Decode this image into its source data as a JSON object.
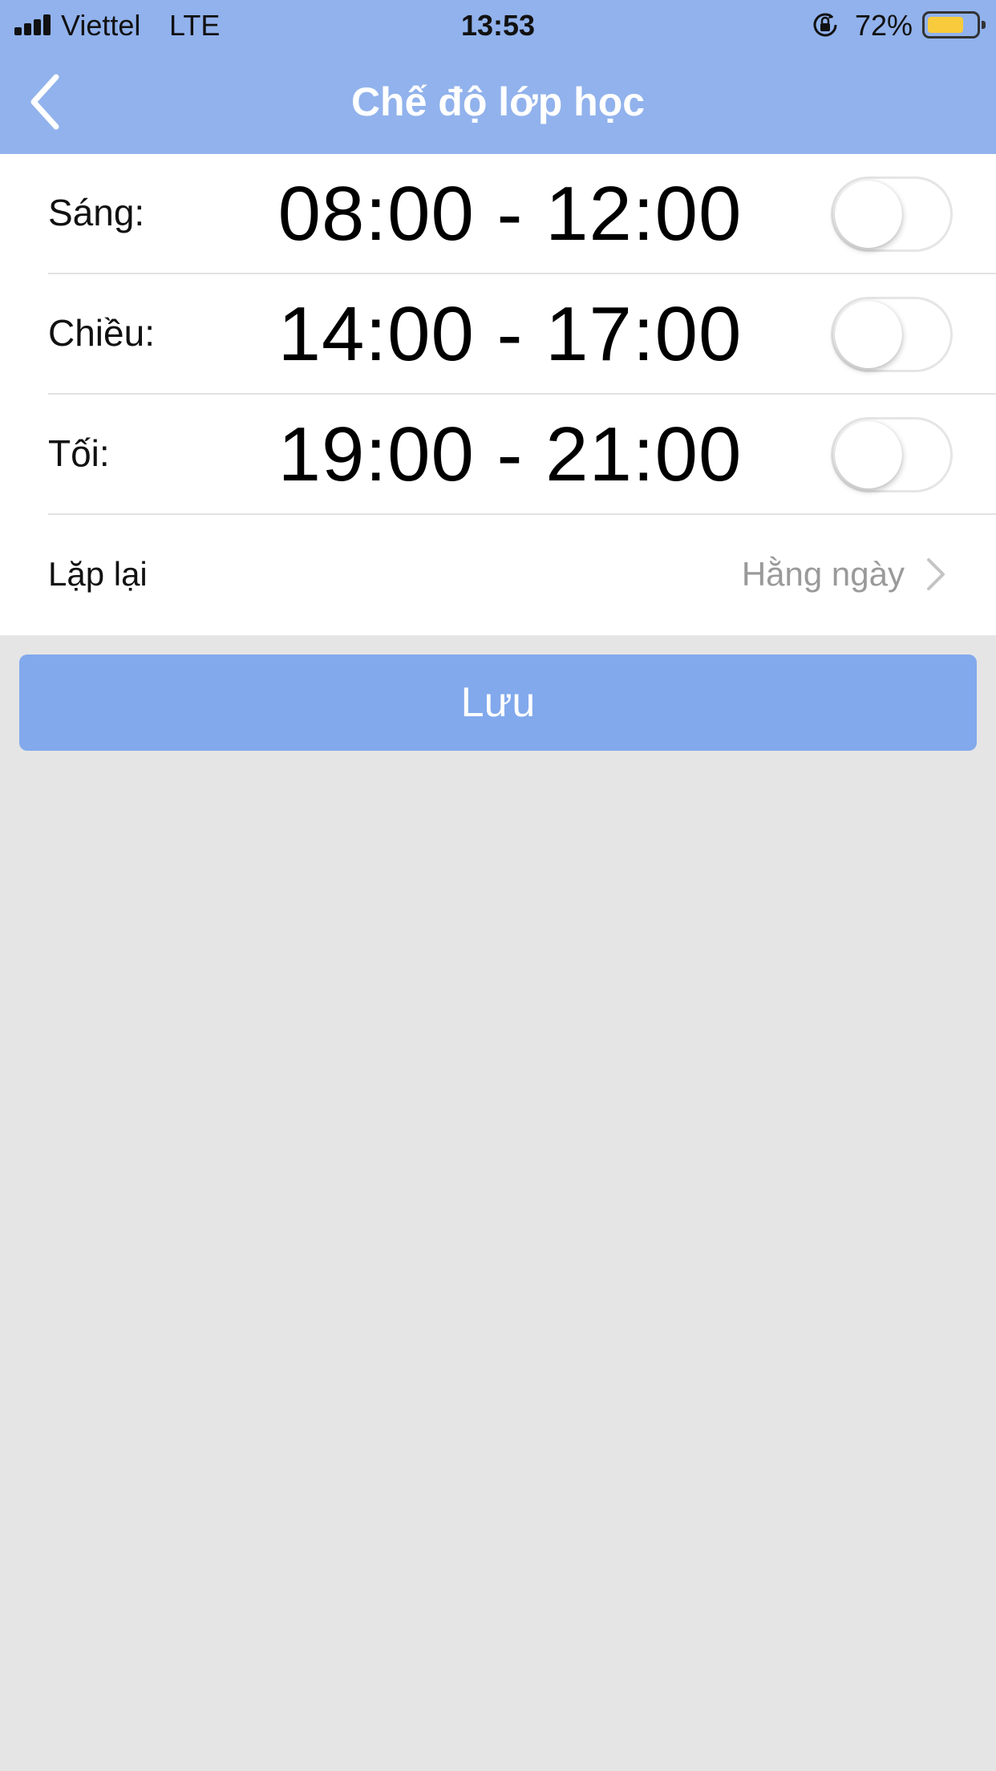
{
  "status_bar": {
    "carrier": "Viettel",
    "network": "LTE",
    "time": "13:53",
    "battery_percent": "72%",
    "battery_level": 0.72,
    "battery_color": "#f7cb3b",
    "icons": [
      "signal-icon",
      "orientation-lock-icon",
      "battery-icon"
    ]
  },
  "header": {
    "title": "Chế độ lớp học",
    "back_icon": "chevron-left-icon",
    "background": "#91b2ec"
  },
  "schedule": {
    "rows": [
      {
        "label": "Sáng:",
        "time_range": "08:00 - 12:00",
        "enabled": false
      },
      {
        "label": "Chiều:",
        "time_range": "14:00 - 17:00",
        "enabled": false
      },
      {
        "label": "Tối:",
        "time_range": "19:00 - 21:00",
        "enabled": false
      }
    ],
    "repeat": {
      "label": "Lặp lại",
      "value": "Hằng ngày",
      "icon": "chevron-right-icon"
    }
  },
  "actions": {
    "save_label": "Lưu",
    "save_color": "#82a9ec"
  }
}
